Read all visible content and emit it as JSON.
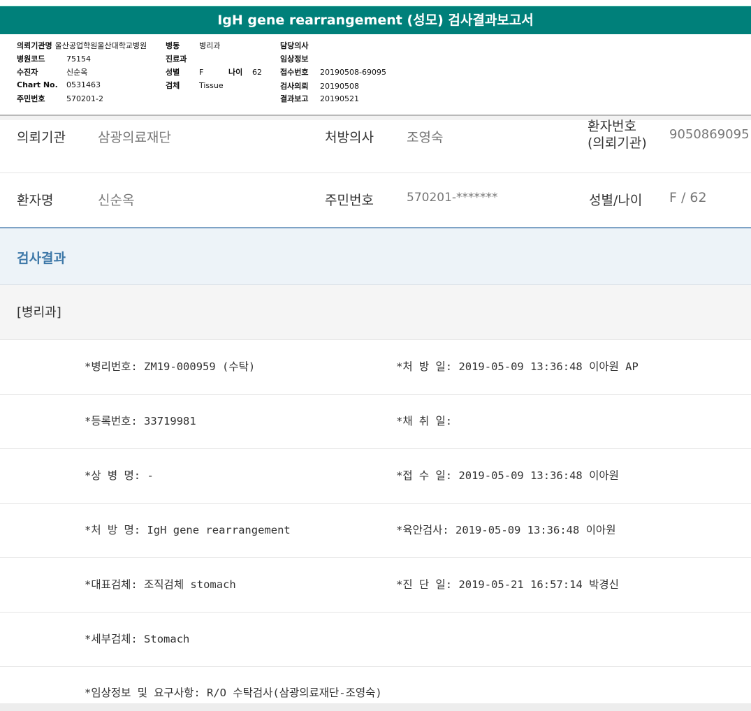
{
  "title": "IgH gene rearrangement (성모) 검사결과보고서",
  "summary": {
    "col1": [
      {
        "label": "의뢰기관명",
        "value": "울산공업학원울산대학교병원"
      },
      {
        "label": "병원코드",
        "value": "75154"
      },
      {
        "label": "수진자",
        "value": "신순옥"
      },
      {
        "label": "Chart No.",
        "value": "0531463"
      },
      {
        "label": "주민번호",
        "value": "570201-2"
      }
    ],
    "col2": [
      {
        "label": "병동",
        "value": "병리과"
      },
      {
        "label": "진료과",
        "value": ""
      },
      {
        "label": "성별",
        "value": "F"
      },
      {
        "label": "검체",
        "value": "Tissue"
      }
    ],
    "age": {
      "label": "나이",
      "value": "62"
    },
    "col3": [
      {
        "label": "담당의사",
        "value": ""
      },
      {
        "label": "임상정보",
        "value": ""
      },
      {
        "label": "접수번호",
        "value": "20190508-69095"
      },
      {
        "label": "검사의뢰",
        "value": "20190508"
      },
      {
        "label": "결과보고",
        "value": "20190521"
      }
    ]
  },
  "patient_info": {
    "row1": {
      "institution_label": "의뢰기관",
      "institution_value": "삼광의료재단",
      "doctor_label": "처방의사",
      "doctor_value": "조영숙",
      "patno_label_1": "환자번호",
      "patno_label_2": "(의뢰기관)",
      "patno_value": "9050869095"
    },
    "row2": {
      "name_label": "환자명",
      "name_value": "신순옥",
      "rrn_label": "주민번호",
      "rrn_value": "570201-*******",
      "sexage_label": "성별/나이",
      "sexage_value": "F / 62"
    }
  },
  "result_section": {
    "header": "검사결과",
    "department": "[병리과]"
  },
  "details": {
    "r1_left": "*병리번호: ZM19-000959 (수탁)",
    "r1_right": "*처 방 일: 2019-05-09 13:36:48  이아원 AP",
    "r2_left": "*등록번호: 33719981",
    "r2_right": "*채 취 일:",
    "r3_left": "*상 병 명: -",
    "r3_right": "*접 수 일: 2019-05-09 13:36:48  이아원",
    "r4_left": "*처 방 명: IgH gene rearrangement",
    "r4_right": "*육안검사: 2019-05-09 13:36:48  이아원",
    "r5_left": "*대표검체: 조직검체 stomach",
    "r5_right": "*진 단 일: 2019-05-21 16:57:14  박경신",
    "r6_left": "*세부검체: Stomach",
    "r7_left": "*임상정보 및 요구사항: R/O 수탁검사(삼광의료재단-조영숙)"
  },
  "colors": {
    "title_bg": "#00807a",
    "section_header_text": "#3e78a8",
    "section_header_bg": "#edf3f8"
  }
}
